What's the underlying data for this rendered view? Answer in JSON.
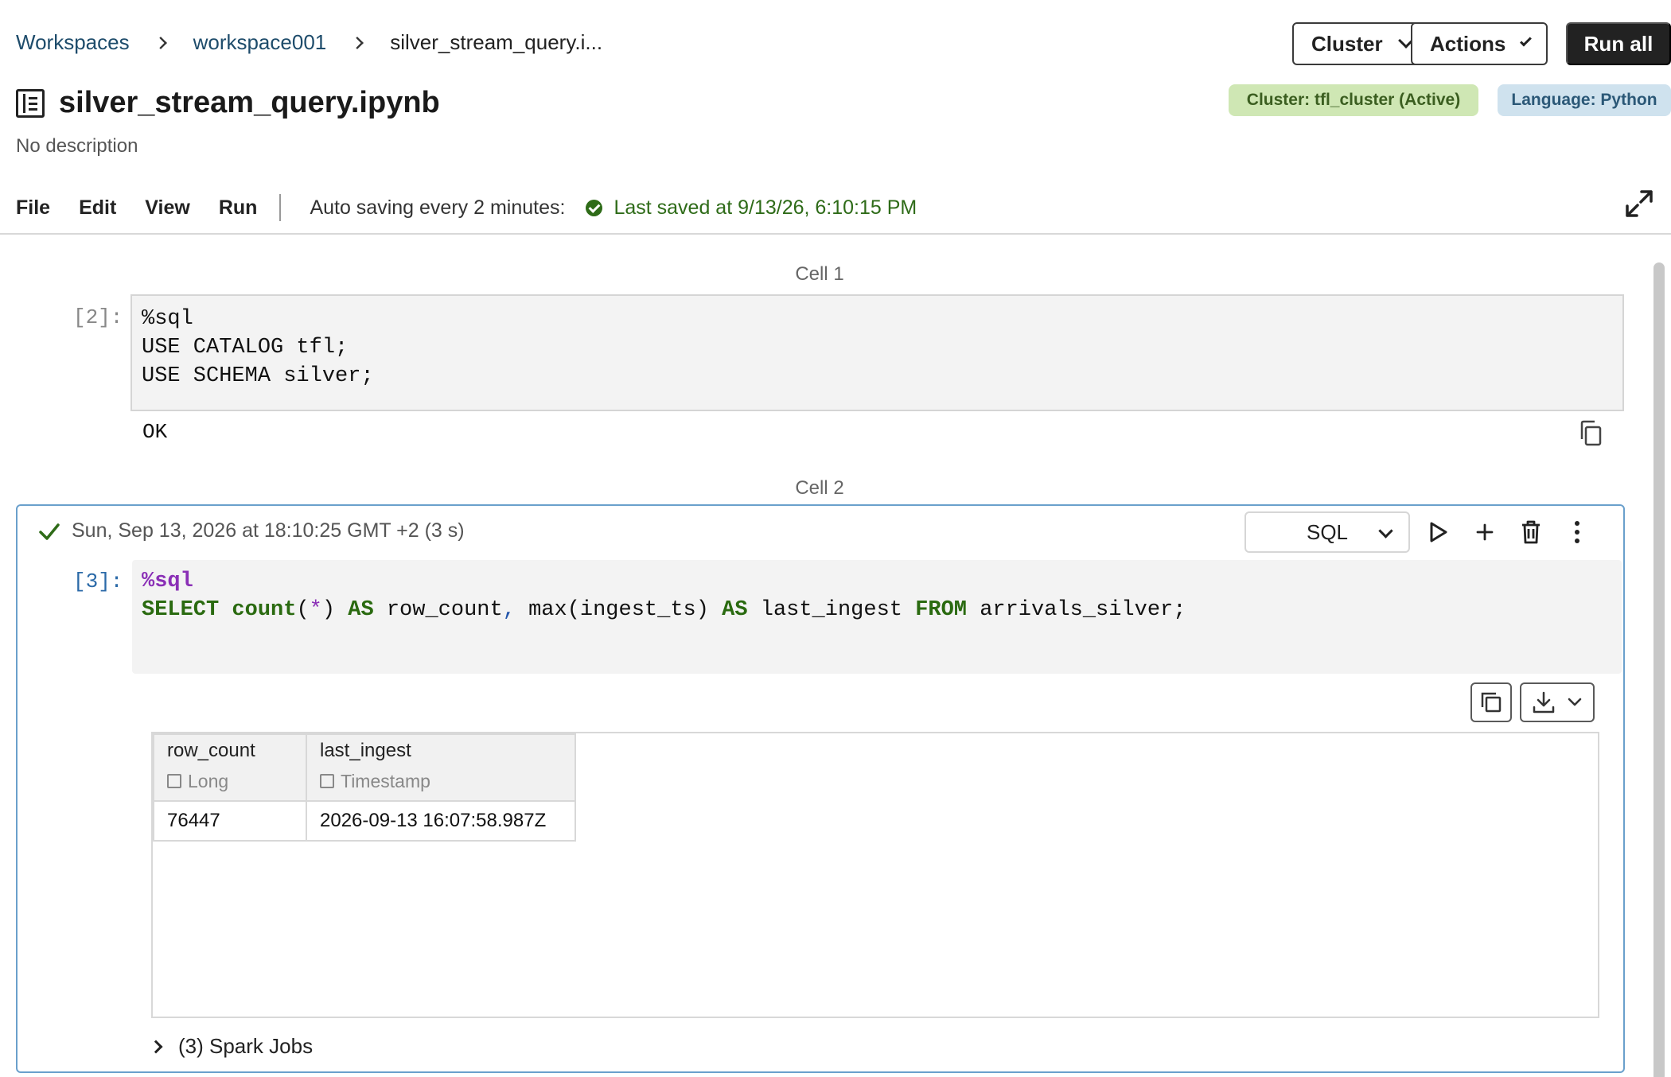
{
  "breadcrumb": {
    "items": [
      "Workspaces",
      "workspace001"
    ],
    "current": "silver_stream_query.i..."
  },
  "header": {
    "title": "silver_stream_query.ipynb",
    "description": "No description",
    "buttons": {
      "cluster": "Cluster",
      "actions": "Actions",
      "run_all": "Run all"
    },
    "badges": {
      "cluster": "Cluster: tfl_cluster (Active)",
      "language": "Language: Python"
    }
  },
  "menu": {
    "items": [
      "File",
      "Edit",
      "View",
      "Run"
    ],
    "autosave": "Auto saving every 2 minutes:",
    "last_saved": "Last saved at 9/13/26, 6:10:15 PM"
  },
  "cells": [
    {
      "label": "Cell 1",
      "exec_count": "[2]:",
      "code_lines": [
        "%sql",
        "USE CATALOG tfl;",
        "USE SCHEMA silver;"
      ],
      "output": "OK"
    },
    {
      "label": "Cell 2",
      "exec_count": "[3]:",
      "status": "Sun, Sep 13, 2026 at 18:10:25 GMT +2 (3 s)",
      "language": "SQL",
      "code": {
        "magic": "%sql",
        "line2": {
          "select": "SELECT",
          "count": "count",
          "open": "(",
          "star": "*",
          "close": ")",
          "as1": "AS",
          "alias1": "row_count",
          "comma": ",",
          "max_expr": "max(ingest_ts)",
          "as2": "AS",
          "alias2": "last_ingest",
          "from": "FROM",
          "table": "arrivals_silver;"
        }
      },
      "result": {
        "columns": [
          {
            "name": "row_count",
            "type": "Long"
          },
          {
            "name": "last_ingest",
            "type": "Timestamp"
          }
        ],
        "rows": [
          [
            "76447",
            "2026-09-13 16:07:58.987Z"
          ]
        ]
      },
      "spark_jobs": "(3) Spark Jobs"
    }
  ],
  "colors": {
    "link": "#1e4c6b",
    "saved_green": "#2e6b18",
    "badge_green_bg": "#cfe7b4",
    "badge_blue_bg": "#cfe2ee",
    "keyword": "#2a6a10",
    "magic": "#8a2fb6",
    "active_cell_border": "#6aa0cc"
  },
  "icons": [
    "notebook-icon",
    "chevron-down-icon",
    "check-circle-icon",
    "expand-icon",
    "copy-icon",
    "check-icon",
    "play-icon",
    "plus-icon",
    "trash-icon",
    "more-vertical-icon",
    "download-icon",
    "chevron-right-icon"
  ]
}
